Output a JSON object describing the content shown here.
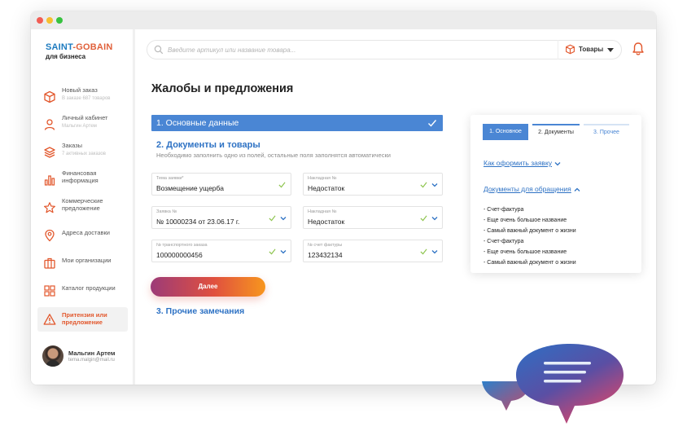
{
  "brand": {
    "line1a": "SAINT",
    "line1b": "-GOBAIN",
    "line2": "для бизнеса"
  },
  "sidebar": {
    "items": [
      {
        "label": "Новый заказ",
        "sub": "В заказе 687 товаров",
        "icon": "cube-icon"
      },
      {
        "label": "Личный кабинет",
        "sub": "Мальгин Артем",
        "icon": "user-icon"
      },
      {
        "label": "Заказы",
        "sub": "7 активных заказов",
        "icon": "layers-icon"
      },
      {
        "label": "Финансовая информация",
        "sub": "",
        "icon": "bar-chart-icon"
      },
      {
        "label": "Коммерческие предложение",
        "sub": "",
        "icon": "star-icon"
      },
      {
        "label": "Адреса доставки",
        "sub": "",
        "icon": "location-pin-icon"
      },
      {
        "label": "Мои организации",
        "sub": "",
        "icon": "briefcase-icon"
      },
      {
        "label": "Каталог продукции",
        "sub": "",
        "icon": "catalog-grid-icon"
      },
      {
        "label": "Притензия или предложение",
        "sub": "",
        "icon": "warning-icon",
        "active": true
      }
    ]
  },
  "user": {
    "name": "Мальгин Артем",
    "email": "tema.malgin@mail.ru"
  },
  "search": {
    "placeholder": "Введите артикул или название товара..."
  },
  "products": {
    "label": "Товары"
  },
  "page": {
    "title": "Жалобы и предложения"
  },
  "form": {
    "section1": "1. Основные данные",
    "section2": "2. Документы и товары",
    "hint": "Необходимо заполнить одно из полей, остальные поля заполнятся автоматически",
    "fields": [
      {
        "label": "Тема заявки*",
        "value": "Возмещение ущерба"
      },
      {
        "label": "Накладная №",
        "value": "Недостаток"
      },
      {
        "label": "Заявка №",
        "value": "№ 10000234 от 23.06.17 г."
      },
      {
        "label": "Накладная №",
        "value": "Недостаток"
      },
      {
        "label": "№ транспортного заказа",
        "value": "100000000456"
      },
      {
        "label": "№ счет фактуры",
        "value": "123432134"
      }
    ],
    "next_label": "Далее",
    "section3": "3. Прочие замечания"
  },
  "panel": {
    "tabs": [
      "1. Основное",
      "2. Документы",
      "3. Прочее"
    ],
    "link1": "Как оформить заявку",
    "link2": "Документы для обращения",
    "docs": [
      "- Счет-фактура",
      "- Еще очень большое название",
      "- Самый важный документ о жизни",
      "- Счет-фактура",
      "- Еще очень большое название",
      "- Самый важный документ о жизни"
    ]
  },
  "colors": {
    "accent": "#4a86d4",
    "brand_orange": "#e2572c",
    "check_green": "#8bc34a"
  }
}
